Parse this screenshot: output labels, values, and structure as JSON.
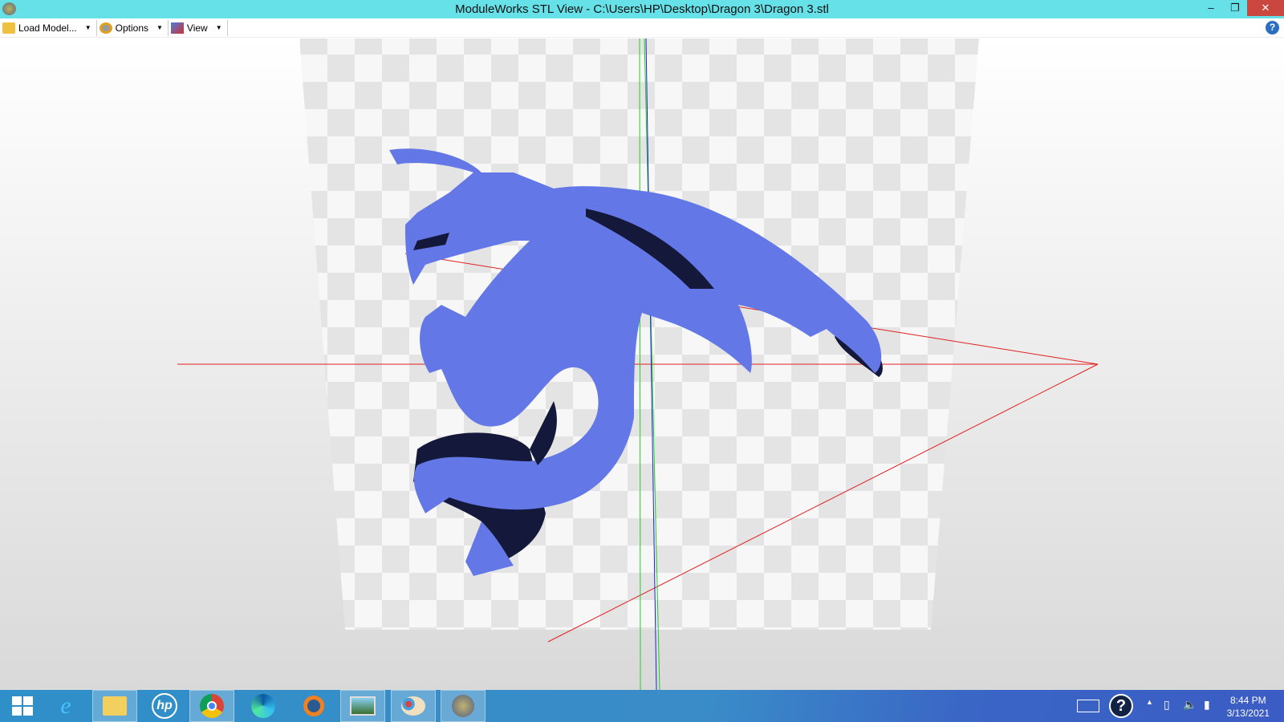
{
  "window": {
    "title": "ModuleWorks STL View - C:\\Users\\HP\\Desktop\\Dragon 3\\Dragon 3.stl",
    "minimize": "–",
    "restore": "❐",
    "close": "✕"
  },
  "toolbar": {
    "load": "Load Model...",
    "options": "Options",
    "view": "View",
    "help": "?"
  },
  "taskbar": {
    "apps": [
      "start",
      "internet-explorer",
      "file-explorer",
      "hp",
      "chrome",
      "edge",
      "blender",
      "photos",
      "paint",
      "moduleworks-stl-view"
    ],
    "time": "8:44 PM",
    "date": "3/13/2021"
  },
  "colors": {
    "model": "#6378e6",
    "shadow": "#14183a",
    "titlebar": "#67e1e8"
  }
}
